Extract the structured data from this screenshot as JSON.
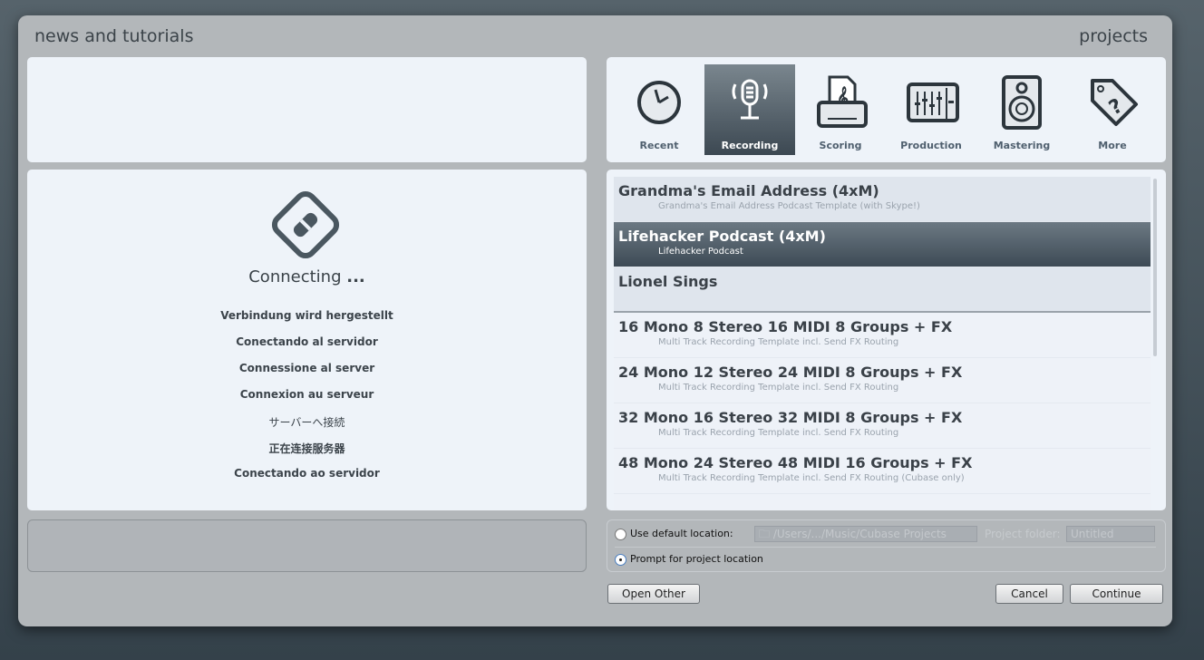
{
  "header": {
    "left_title": "news and tutorials",
    "right_title": "projects"
  },
  "connecting": {
    "title": "Connecting",
    "dots": "...",
    "languages": [
      "Verbindung wird hergestellt",
      "Conectando al servidor",
      "Connessione al server",
      "Connexion au serveur",
      "サーバーへ接続",
      "正在连接服务器",
      "Conectando ao servidor"
    ]
  },
  "tabs": [
    {
      "label": "Recent",
      "icon": "clock-icon"
    },
    {
      "label": "Recording",
      "icon": "microphone-icon",
      "selected": true
    },
    {
      "label": "Scoring",
      "icon": "score-printer-icon"
    },
    {
      "label": "Production",
      "icon": "mixer-faders-icon"
    },
    {
      "label": "Mastering",
      "icon": "speaker-icon"
    },
    {
      "label": "More",
      "icon": "tag-question-icon"
    }
  ],
  "templates": [
    {
      "title": "Grandma's Email Address (4xM)",
      "subtitle": "Grandma's Email Address Podcast Template (with Skype!)"
    },
    {
      "title": "Lifehacker Podcast (4xM)",
      "subtitle": "Lifehacker Podcast",
      "selected": true
    },
    {
      "title": "Lionel Sings",
      "subtitle": ""
    },
    {
      "title": "16 Mono 8 Stereo 16 MIDI 8 Groups + FX",
      "subtitle": "Multi Track Recording Template incl. Send FX Routing"
    },
    {
      "title": "24 Mono 12 Stereo 24 MIDI 8 Groups + FX",
      "subtitle": "Multi Track Recording Template incl. Send FX Routing"
    },
    {
      "title": "32 Mono 16 Stereo 32 MIDI 8 Groups + FX",
      "subtitle": "Multi Track Recording Template incl. Send FX Routing"
    },
    {
      "title": "48 Mono 24 Stereo 48 MIDI 16 Groups + FX",
      "subtitle": "Multi Track Recording Template incl. Send FX Routing (Cubase only)"
    }
  ],
  "location": {
    "default_label": "Use default location:",
    "path": "/Users/.../Music/Cubase Projects",
    "folder_label": "Project folder:",
    "folder_value": "Untitled",
    "prompt_label": "Prompt for project location",
    "selected": "prompt"
  },
  "buttons": {
    "open_other": "Open Other",
    "cancel": "Cancel",
    "continue": "Continue"
  }
}
